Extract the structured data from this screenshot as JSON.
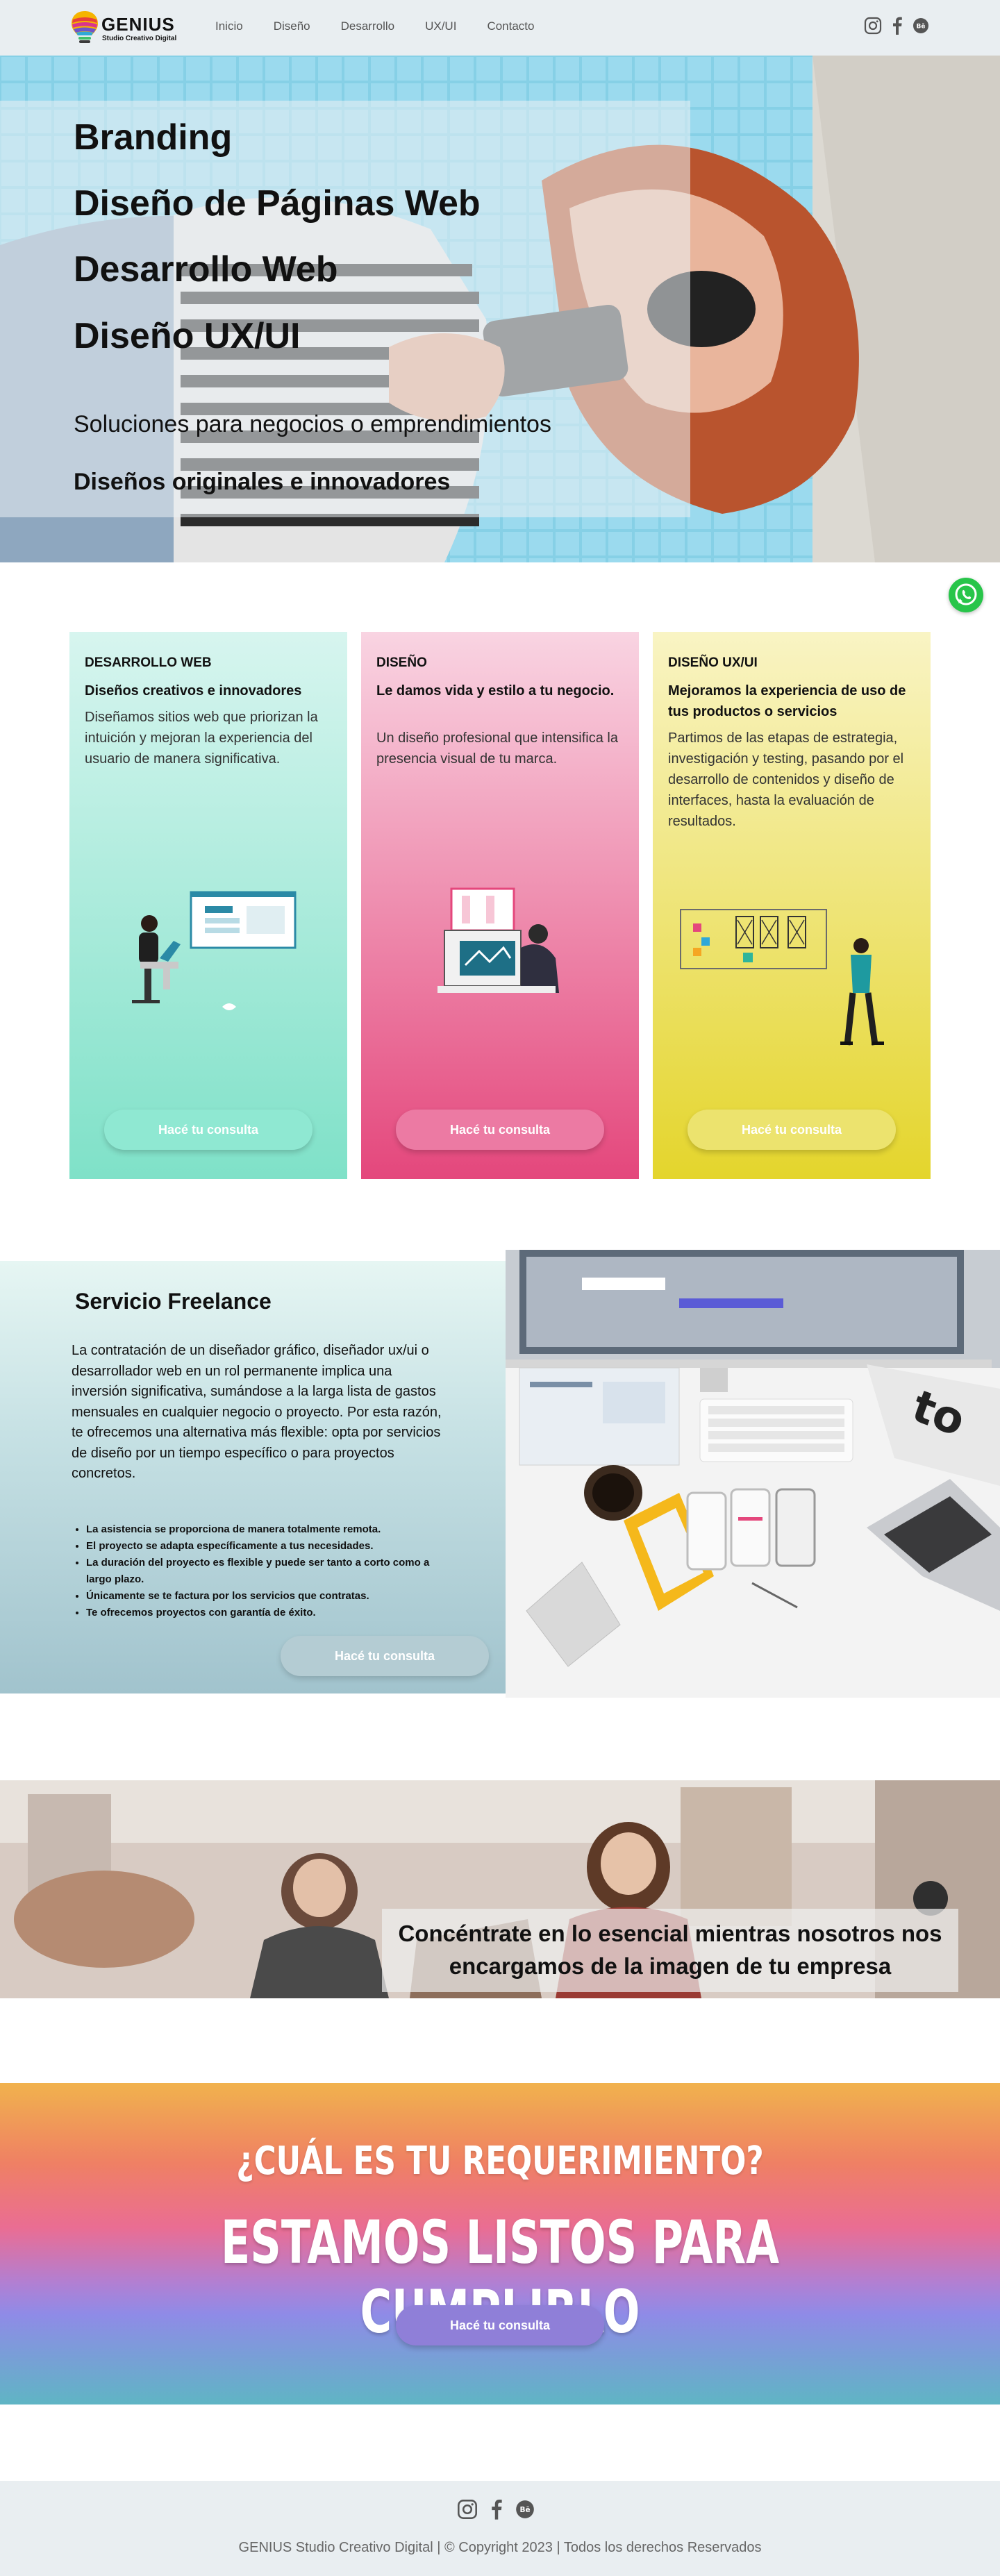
{
  "header": {
    "logo_text": "GENIUS",
    "logo_sub": "Studio Creativo Digital",
    "nav": [
      "Inicio",
      "Diseño",
      "Desarrollo",
      "UX/UI",
      "Contacto"
    ]
  },
  "hero": {
    "headings": [
      "Branding",
      "Diseño de Páginas Web",
      "Desarrollo Web",
      "Diseño UX/UI"
    ],
    "subtitle": "Soluciones para negocios o emprendimientos",
    "tagline": "Diseños originales e innovadores"
  },
  "cards": [
    {
      "title": "DESARROLLO WEB",
      "heading": "Diseños creativos e innovadores",
      "body": "Diseñamos sitios web que priorizan la intuición y mejoran la experiencia del usuario de manera significativa.",
      "button": "Hacé tu consulta",
      "colors": {
        "top": "#d7f5ef",
        "bottom": "#7fe1c8",
        "button": "#8fe8d2"
      }
    },
    {
      "title": "DISEÑO",
      "heading": "Le damos vida y estilo a tu negocio.",
      "body": "Un diseño profesional que intensifica la presencia visual de tu marca.",
      "button": "Hacé tu consulta",
      "colors": {
        "top": "#f9d4e2",
        "bottom": "#e4477c",
        "button": "#ec7aa3"
      }
    },
    {
      "title": "DISEÑO UX/UI",
      "heading": "Mejoramos la experiencia de uso de tus productos o servicios",
      "body": "Partimos de las etapas de estrategia, investigación y testing, pasando por el desarrollo de contenidos y diseño de interfaces, hasta la evaluación de resultados.",
      "button": "Hacé tu consulta",
      "colors": {
        "top": "#f9f4c4",
        "bottom": "#e4d52c",
        "button": "#ece36e"
      }
    }
  ],
  "freelance": {
    "title": "Servicio Freelance",
    "text": "La contratación de un diseñador gráfico, diseñador ux/ui o desarrollador web en un rol permanente implica una inversión significativa, sumándose a la larga lista de gastos mensuales en cualquier negocio o proyecto. Por esta razón, te ofrecemos una alternativa más flexible: opta por servicios de diseño por un tiempo específico o para proyectos concretos.",
    "list": [
      "La asistencia se proporciona de manera totalmente remota.",
      "El proyecto se adapta específicamente a tus necesidades.",
      "La duración del proyecto es flexible y puede ser tanto a corto como a largo plazo.",
      "Únicamente se te factura por los servicios que contratas.",
      "Te ofrecemos proyectos con garantía de éxito."
    ],
    "button": "Hacé tu consulta"
  },
  "banner": {
    "text": "Concéntrate en lo esencial mientras nosotros nos encargamos de la imagen de tu empresa"
  },
  "cta": {
    "line1": "¿CUÁL ES TU REQUERIMIENTO?",
    "line2": "ESTAMOS LISTOS PARA CUMPLIRLO",
    "button": "Hacé tu consulta"
  },
  "footer": {
    "copyright": "GENIUS Studio Creativo Digital | © Copyright  2023 | Todos los derechos Reservados"
  },
  "icons": [
    "instagram-icon",
    "facebook-icon",
    "behance-icon",
    "whatsapp-icon"
  ]
}
